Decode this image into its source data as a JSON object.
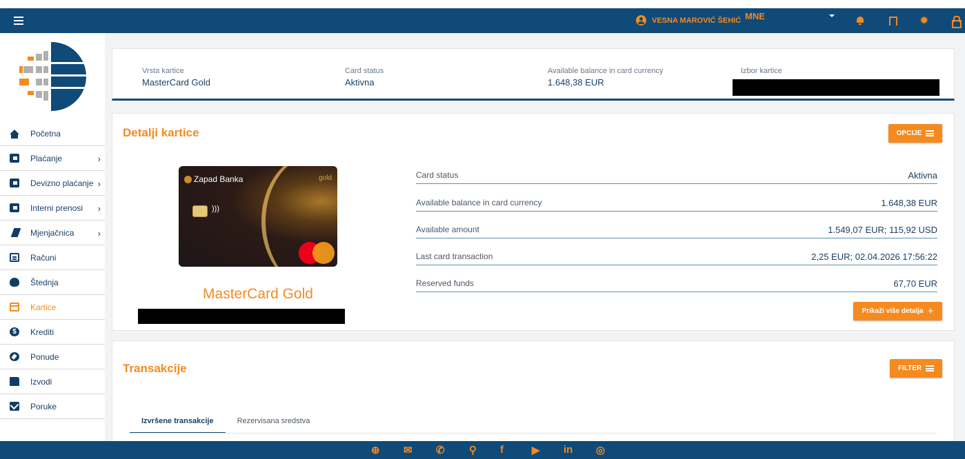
{
  "header": {
    "user_name": "VESNA MAROVIĆ ŠEHIĆ",
    "language": "MNE"
  },
  "sidebar": {
    "items": [
      {
        "label": "Početna",
        "icon": "home-icon"
      },
      {
        "label": "Plaćanje",
        "icon": "wallet-icon"
      },
      {
        "label": "Devizno plaćanje",
        "icon": "wallet-icon"
      },
      {
        "label": "Interni prenosi",
        "icon": "wallet-icon"
      },
      {
        "label": "Mjenjačnica",
        "icon": "exchange-icon"
      },
      {
        "label": "Računi",
        "icon": "document-icon"
      },
      {
        "label": "Štednja",
        "icon": "piggy-bank-icon"
      },
      {
        "label": "Kartice",
        "icon": "credit-card-icon"
      },
      {
        "label": "Krediti",
        "icon": "dollar-icon"
      },
      {
        "label": "Ponude",
        "icon": "compass-icon"
      },
      {
        "label": "Izvodi",
        "icon": "folder-icon"
      },
      {
        "label": "Poruke",
        "icon": "mail-icon"
      }
    ]
  },
  "summary": {
    "card_type_label": "Vrsta kartice",
    "card_type_value": "MasterCard Gold",
    "status_label": "Card status",
    "status_value": "Aktivna",
    "balance_label": "Available balance in card currency",
    "balance_value": "1.648,38 EUR",
    "select_label": "Izbor kartice"
  },
  "details": {
    "title": "Detalji kartice",
    "options_button": "OPCIJE",
    "card_bank": "Zapad Banka",
    "card_tier": "gold",
    "card_name": "MasterCard Gold",
    "rows": [
      {
        "label": "Card status",
        "value": "Aktivna"
      },
      {
        "label": "Available balance in card currency",
        "value": "1.648,38 EUR"
      },
      {
        "label": "Available amount",
        "value": "1.549,07 EUR; 115,92 USD"
      },
      {
        "label": "Last card transaction",
        "value": "2,25 EUR; 02.04.2026 17:56:22"
      },
      {
        "label": "Reserved funds",
        "value": "67,70 EUR"
      }
    ],
    "more_button": "Prikaži više detalja"
  },
  "transactions": {
    "title": "Transakcije",
    "filter_button": "FILTER",
    "tabs": [
      "Izvršene transakcije",
      "Rezervisana sredstva"
    ]
  },
  "colors": {
    "primary": "#0f4a78",
    "accent": "#f58a1f",
    "text": "#1c3f66"
  },
  "footer_icons": [
    "globe-icon",
    "mail-icon",
    "phone-icon",
    "location-icon",
    "facebook-icon",
    "youtube-icon",
    "linkedin-icon",
    "instagram-icon"
  ]
}
